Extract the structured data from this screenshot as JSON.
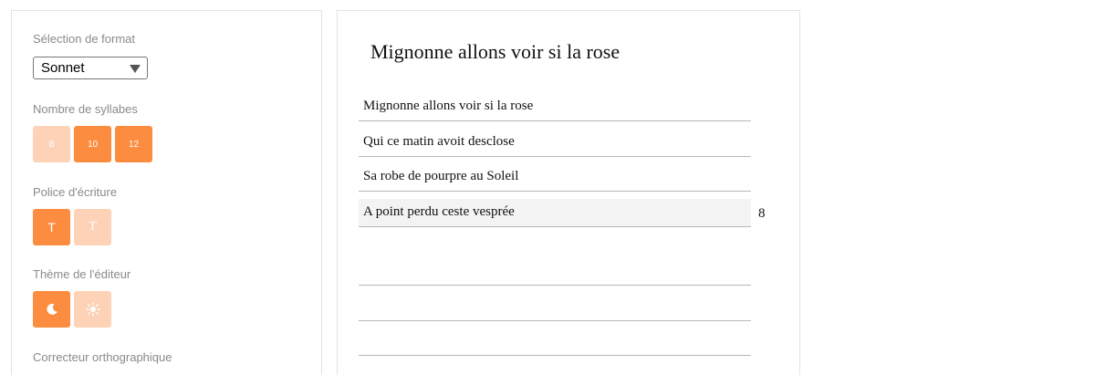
{
  "settings": {
    "format_label": "Sélection de format",
    "format_value": "Sonnet",
    "syllables_label": "Nombre de syllabes",
    "syllable_options": [
      "8",
      "10",
      "12"
    ],
    "font_label": "Police d'écriture",
    "font_options": [
      "T",
      "T"
    ],
    "theme_label": "Thème de l'éditeur",
    "theme_options": [
      "moon-icon",
      "sun-icon"
    ],
    "spellcheck_label": "Correcteur orthographique"
  },
  "editor": {
    "title": "Mignonne allons voir si la rose",
    "lines": [
      "Mignonne allons voir si la rose",
      "Qui ce matin avoit desclose",
      "Sa robe de pourpre au Soleil",
      "A point perdu ceste vesprée",
      "",
      "",
      ""
    ],
    "focused_line_syllables": "8"
  },
  "colors": {
    "accent": "#fc8c3f",
    "accent_light": "#fdd2b6"
  }
}
